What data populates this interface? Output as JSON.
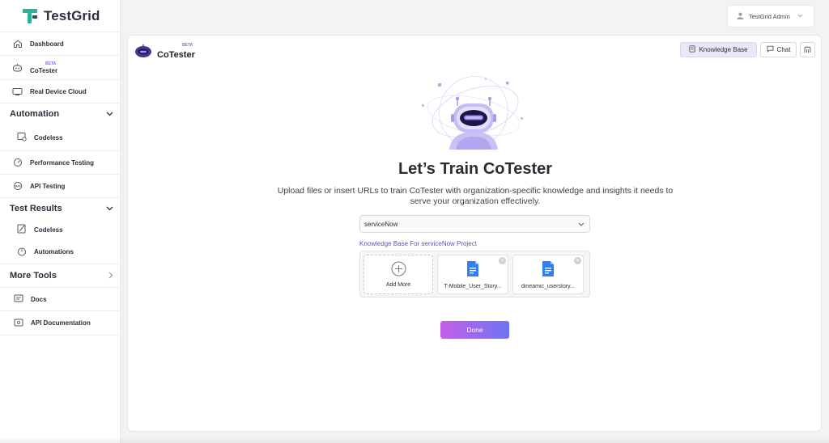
{
  "brand": {
    "name": "TestGrid",
    "accent": "#2bb39a"
  },
  "user": {
    "name": "TestGrid Admin"
  },
  "sidebar": {
    "top_items": [
      {
        "label": "Dashboard",
        "icon": "home-icon"
      },
      {
        "label": "CoTester",
        "badge": "BETA",
        "icon": "robot-icon"
      },
      {
        "label": "Real Device Cloud",
        "icon": "device-cloud-icon"
      }
    ],
    "automation": {
      "title": "Automation",
      "items": [
        {
          "label": "Codeless",
          "icon": "codeless-icon"
        }
      ]
    },
    "mid_items": [
      {
        "label": "Performance Testing",
        "icon": "gauge-icon"
      },
      {
        "label": "API Testing",
        "icon": "api-icon"
      }
    ],
    "test_results": {
      "title": "Test Results",
      "items": [
        {
          "label": "Codeless",
          "icon": "pen-icon"
        },
        {
          "label": "Automations",
          "icon": "timer-icon"
        }
      ]
    },
    "more_tools": {
      "title": "More Tools",
      "items": [
        {
          "label": "Docs",
          "icon": "docs-icon"
        },
        {
          "label": "API Documentation",
          "icon": "api-docs-icon"
        }
      ]
    }
  },
  "header": {
    "product": "CoTester",
    "badge": "BETA",
    "knowledge_base_label": "Knowledge Base",
    "chat_label": "Chat"
  },
  "main": {
    "title": "Let’s Train CoTester",
    "subtitle": "Upload files or insert URLs to train CoTester with organization-specific knowledge and insights it needs to serve your organization effectively.",
    "project_select": "serviceNow",
    "kb_label": "Knowledge Base For serviceNow Project",
    "add_more_label": "Add More",
    "files": [
      {
        "name": "T-Mobile_User_Story..."
      },
      {
        "name": "dineamic_userstory..."
      }
    ],
    "done_label": "Done"
  }
}
